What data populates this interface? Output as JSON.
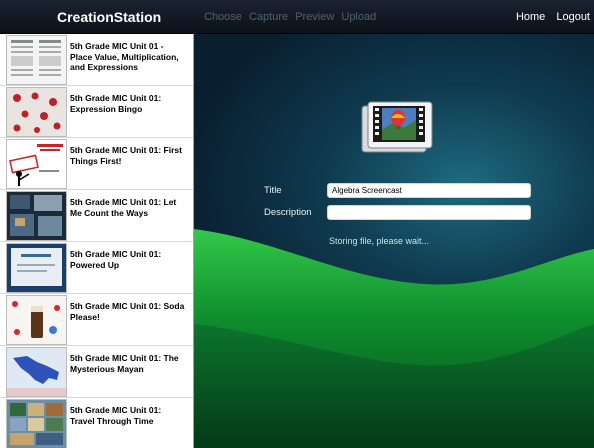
{
  "app": {
    "title": "CreationStation"
  },
  "steps": [
    "Choose",
    "Capture",
    "Preview",
    "Upload"
  ],
  "nav": {
    "home": "Home",
    "logout": "Logout"
  },
  "sidebar": {
    "items": [
      {
        "label": "5th Grade MIC Unit 01 - Place Value, Multiplication, and Expressions",
        "thumb": "document-thumbnail"
      },
      {
        "label": "5th Grade MIC Unit 01: Expression Bingo",
        "thumb": "bingo-thumbnail"
      },
      {
        "label": "5th Grade MIC Unit 01: First Things First!",
        "thumb": "order-of-operations-thumbnail"
      },
      {
        "label": "5th Grade MIC Unit 01: Let Me Count the Ways",
        "thumb": "slides-thumbnail"
      },
      {
        "label": "5th Grade MIC Unit 01: Powered Up",
        "thumb": "presentation-thumbnail"
      },
      {
        "label": "5th Grade MIC Unit 01: Soda Please!",
        "thumb": "soda-thumbnail"
      },
      {
        "label": "5th Grade MIC Unit 01: The Mysterious Mayan",
        "thumb": "map-thumbnail"
      },
      {
        "label": "5th Grade MIC Unit 01: Travel Through Time",
        "thumb": "collage-thumbnail"
      }
    ]
  },
  "form": {
    "title_label": "Title",
    "title_value": "Algebra Screencast",
    "description_label": "Description",
    "description_value": ""
  },
  "status": "Storing file, please wait...",
  "colors": {
    "topbar": "#131a24",
    "wave_green": "#1aa83a",
    "inactive_step": "#4f6070"
  }
}
